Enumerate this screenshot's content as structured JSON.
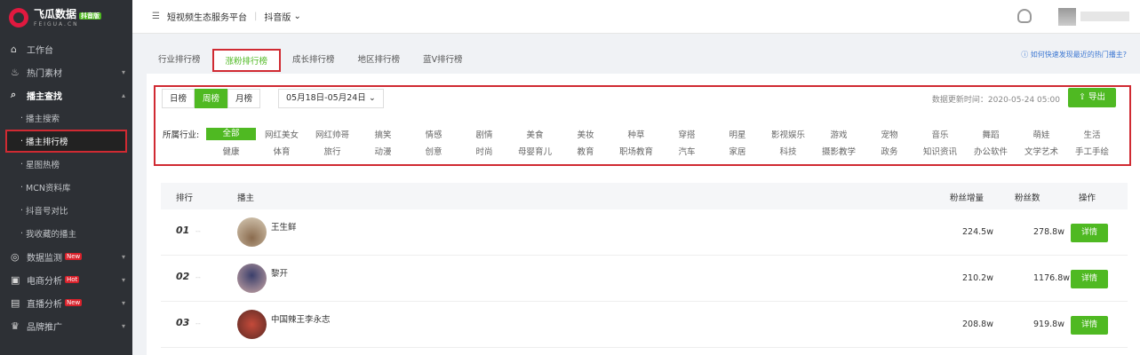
{
  "logo": {
    "name": "飞瓜数据",
    "badge": "抖音版",
    "sub": "FEIGUA.CN"
  },
  "sidebar": {
    "workbench": "工作台",
    "hot": "热门素材",
    "search": "播主查找",
    "sub": [
      "播主搜索",
      "播主排行榜",
      "星图热榜",
      "MCN资料库",
      "抖音号对比",
      "我收藏的播主"
    ],
    "monitor": "数据监测",
    "ecom": "电商分析",
    "live": "直播分析",
    "brand": "品牌推广",
    "new_badge": "New",
    "hot_badge": "Hot"
  },
  "header": {
    "title": "短视频生态服务平台",
    "version": "抖音版"
  },
  "tabs": [
    "行业排行榜",
    "涨粉排行榜",
    "成长排行榜",
    "地区排行榜",
    "蓝V排行榜"
  ],
  "hint": "如何快速发现最近的热门播主?",
  "filter": {
    "periods": [
      "日榜",
      "周榜",
      "月榜"
    ],
    "range": "05月18日-05月24日",
    "updated": "数据更新时间：2020-05-24 05:00",
    "export": "导出",
    "industry_label": "所属行业:",
    "row1": [
      "全部",
      "网红美女",
      "网红帅哥",
      "搞笑",
      "情感",
      "剧情",
      "美食",
      "美妆",
      "种草",
      "穿搭",
      "明星",
      "影视娱乐",
      "游戏",
      "宠物",
      "音乐",
      "舞蹈",
      "萌娃",
      "生活"
    ],
    "row2": [
      "健康",
      "体育",
      "旅行",
      "动漫",
      "创意",
      "时尚",
      "母婴育儿",
      "教育",
      "职场教育",
      "汽车",
      "家居",
      "科技",
      "摄影教学",
      "政务",
      "知识资讯",
      "办公软件",
      "文学艺术",
      "手工手绘"
    ]
  },
  "table": {
    "headers": [
      "排行",
      "播主",
      "粉丝增量",
      "粉丝数",
      "操作"
    ],
    "rows": [
      {
        "rank": "01",
        "name": "王生鲜",
        "inc": "224.5w",
        "fans": "278.8w",
        "action": "详情"
      },
      {
        "rank": "02",
        "name": "黎开",
        "inc": "210.2w",
        "fans": "1176.8w",
        "action": "详情"
      },
      {
        "rank": "03",
        "name": "中国辣王李永志",
        "inc": "208.8w",
        "fans": "919.8w",
        "action": "详情"
      }
    ]
  },
  "colors": {
    "accent": "#4fb922",
    "highlight": "#d02a32",
    "sidebar": "#2d3035"
  }
}
